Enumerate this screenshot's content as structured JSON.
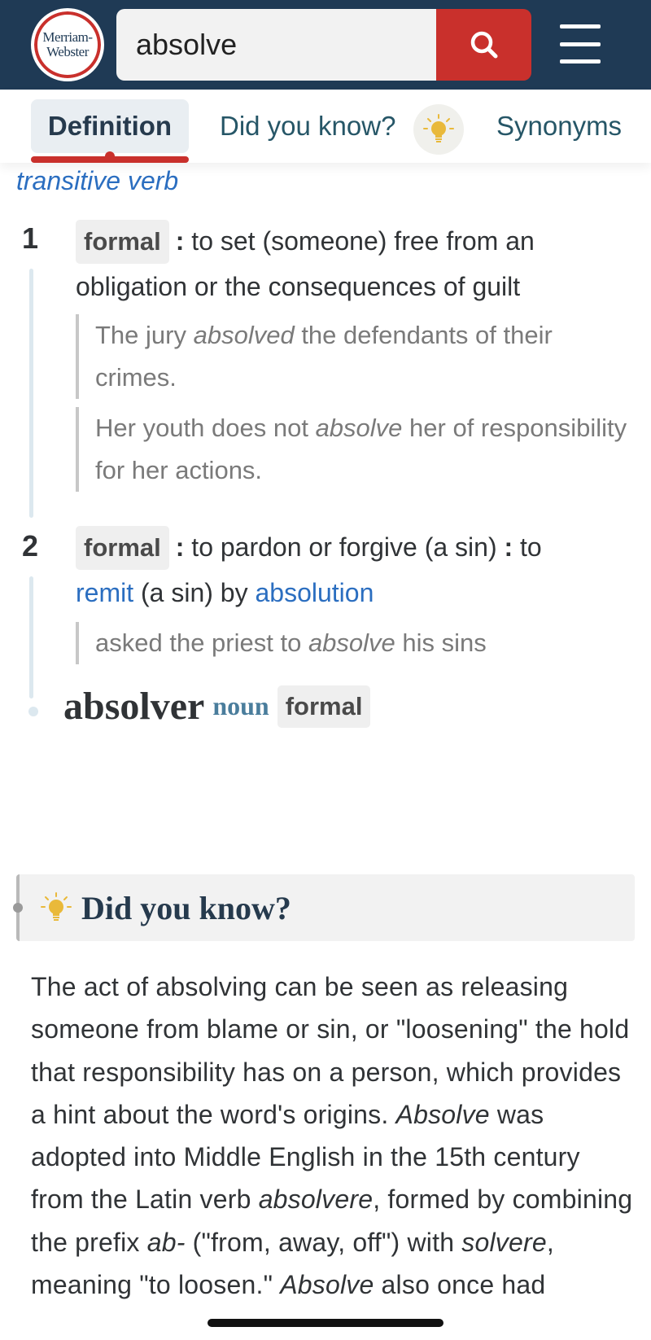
{
  "header": {
    "logo_line1": "Merriam-",
    "logo_line2": "Webster",
    "search_value": "absolve"
  },
  "tabs": [
    {
      "label": "Definition"
    },
    {
      "label": "Did you know?"
    },
    {
      "label": "Synonyms"
    }
  ],
  "entry": {
    "part_of_speech": "transitive verb",
    "senses": [
      {
        "number": "1",
        "label": "formal",
        "colon": ":",
        "definition": "to set (someone) free from an obligation or the consequences of guilt",
        "examples": [
          {
            "before": "The jury ",
            "highlight": "absolved",
            "after": " the defendants of their crimes."
          },
          {
            "before": "Her youth does not ",
            "highlight": "absolve",
            "after": " her of responsibility for her actions."
          }
        ]
      },
      {
        "number": "2",
        "label": "formal",
        "colon": ":",
        "definition_a": "to pardon or forgive (a sin)",
        "colon2": ":",
        "definition_b": "to",
        "link1": "remit",
        "middle": "(a sin) by",
        "link2": "absolution",
        "examples": [
          {
            "before": "asked the priest to ",
            "highlight": "absolve",
            "after": " his sins"
          }
        ]
      }
    ],
    "run_on": {
      "word": "absolver",
      "pos": "noun",
      "label": "formal"
    }
  },
  "did_you_know": {
    "title": "Did you know?",
    "p1": "The act of absolving can be seen as releasing someone from blame or sin, or \"loosening\" the hold that responsibility has on a person, which provides a hint about the word's origins. ",
    "i1": "Absolve",
    "p2": " was adopted into Middle English in the 15th century from the Latin verb ",
    "i2": "absolvere",
    "p3": ", formed by combining the prefix ",
    "i3": "ab-",
    "p4": " (\"from, away, off\") with ",
    "i4": "solvere",
    "p5": ", meaning \"to loosen.\" ",
    "i5": "Absolve",
    "p6": " also once had"
  },
  "colors": {
    "header_bg": "#1f3a55",
    "accent_red": "#c9302c",
    "link_blue": "#2b6ec0",
    "bulb_yellow": "#e9b93a"
  }
}
